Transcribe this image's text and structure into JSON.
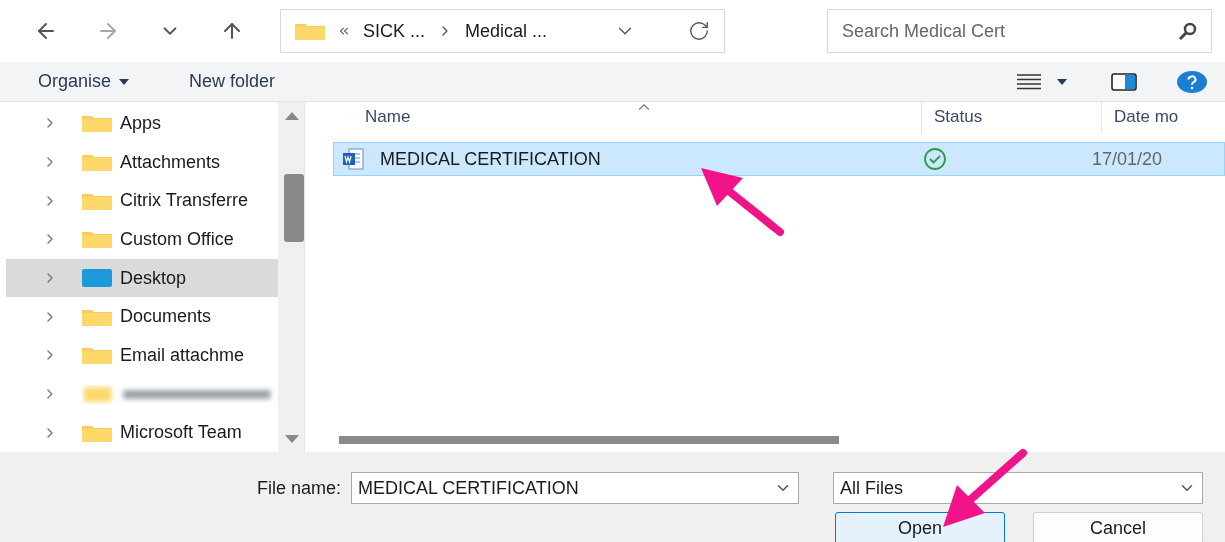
{
  "navigation": {
    "back_disabled": false,
    "forward_disabled": true
  },
  "address_bar": {
    "segments": [
      "SICK ...",
      "Medical ..."
    ]
  },
  "search": {
    "placeholder": "Search Medical Cert"
  },
  "toolbar": {
    "organise": "Organise",
    "new_folder": "New folder"
  },
  "sidebar": {
    "items": [
      {
        "label": "Apps",
        "kind": "folder",
        "selected": false
      },
      {
        "label": "Attachments",
        "kind": "folder",
        "selected": false
      },
      {
        "label": "Citrix Transferre",
        "kind": "folder",
        "selected": false
      },
      {
        "label": "Custom Office",
        "kind": "folder",
        "selected": false
      },
      {
        "label": "Desktop",
        "kind": "desktop",
        "selected": true
      },
      {
        "label": "Documents",
        "kind": "folder",
        "selected": false
      },
      {
        "label": "Email attachme",
        "kind": "folder",
        "selected": false
      },
      {
        "kind": "redacted",
        "selected": false
      },
      {
        "label": "Microsoft Team",
        "kind": "folder",
        "selected": false
      }
    ]
  },
  "table": {
    "columns": [
      "Name",
      "Status",
      "Date mo"
    ],
    "rows": [
      {
        "name": "MEDICAL CERTIFICATION",
        "synced": true,
        "date": "17/01/20",
        "selected": true
      }
    ]
  },
  "footer": {
    "file_name_label": "File name:",
    "file_name": "MEDICAL CERTIFICATION",
    "file_type": "All Files",
    "buttons": [
      {
        "label": "Open",
        "default": true
      },
      {
        "label": "Cancel",
        "default": false
      }
    ]
  },
  "annotations": {
    "arrow_to_file": true,
    "arrow_to_open_button": true
  }
}
